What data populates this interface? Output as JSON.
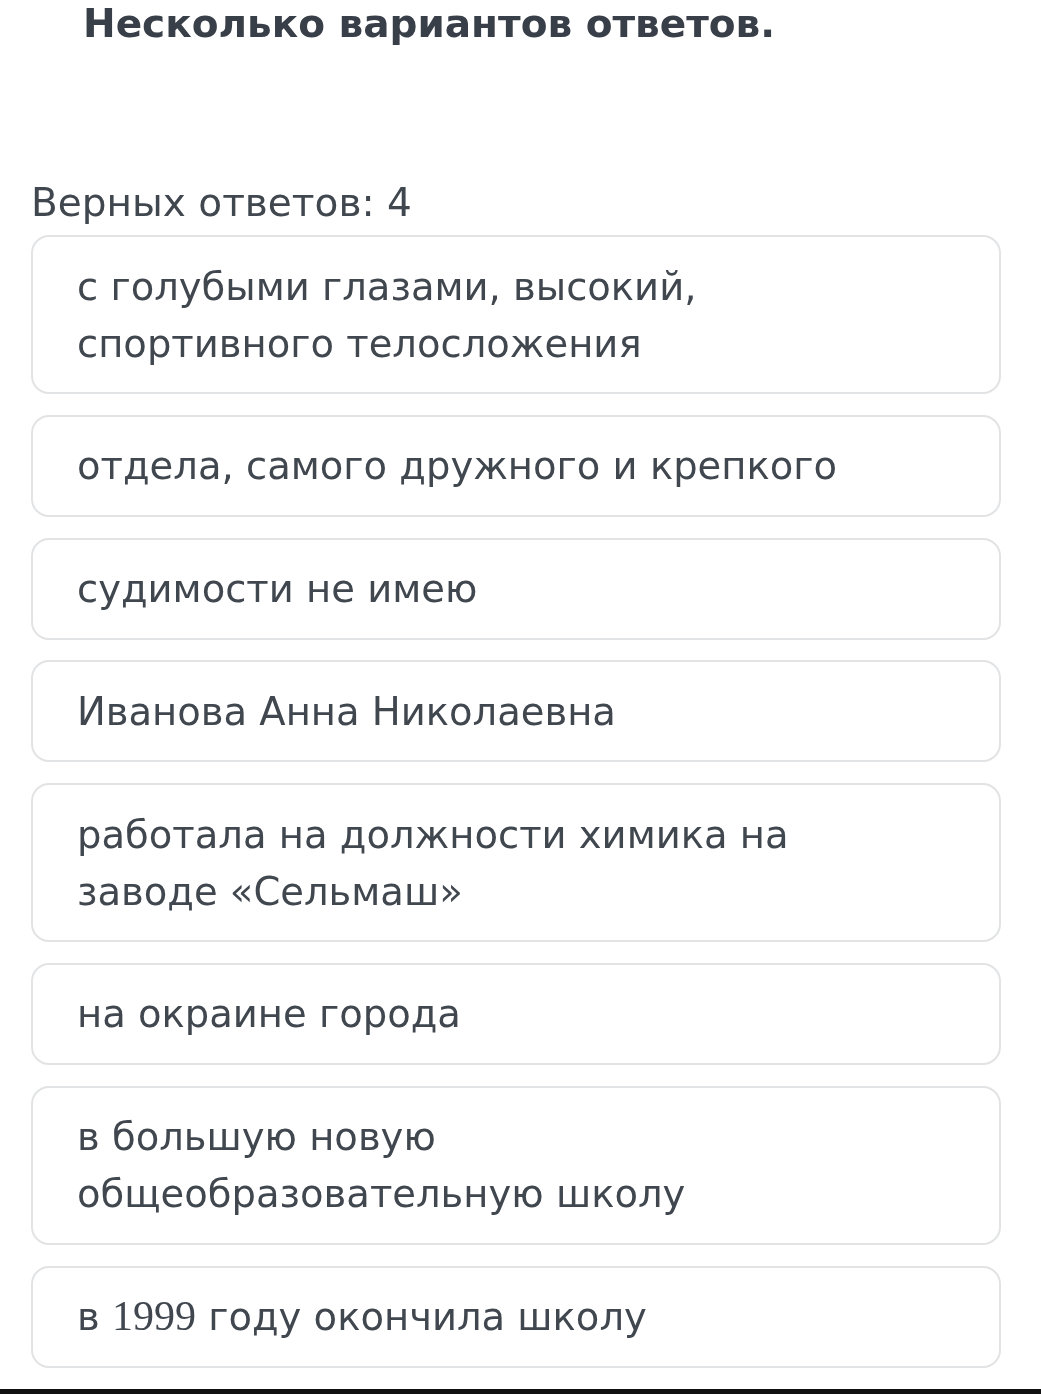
{
  "question": {
    "title": "Несколько вариантов ответов.",
    "answer_count_label": "Верных ответов: 4"
  },
  "options": [
    {
      "text": "с голубыми глазами, высокий, спортивного телосложения",
      "selected": false
    },
    {
      "text": "отдела, самого дружного и крепкого",
      "selected": false
    },
    {
      "text": "судимости не имею",
      "selected": false
    },
    {
      "text": "Иванова Анна Николаевна",
      "selected": false
    },
    {
      "text": "работала на должности химика на заводе «Сельмаш»",
      "selected": false
    },
    {
      "text": "на окраине города",
      "selected": false
    },
    {
      "text": "в большую новую общеобразовательную школу",
      "selected": false
    },
    {
      "segments": [
        {
          "kind": "plain",
          "text": "в "
        },
        {
          "kind": "serif",
          "text": "1999"
        },
        {
          "kind": "plain",
          "text": " году окончила школу"
        }
      ],
      "selected": false
    }
  ]
}
